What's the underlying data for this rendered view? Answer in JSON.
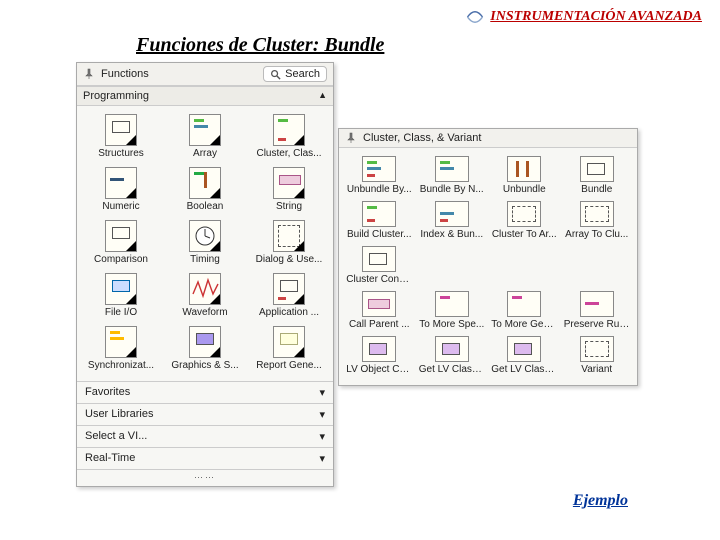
{
  "header": {
    "text": "INSTRUMENTACIÓN AVANZADA"
  },
  "title": "Funciones de Cluster: Bundle",
  "ejemplo_link": "Ejemplo",
  "functions_panel": {
    "title": "Functions",
    "search_label": "Search",
    "programming_section": "Programming",
    "items": [
      {
        "label": "Structures"
      },
      {
        "label": "Array"
      },
      {
        "label": "Cluster, Clas..."
      },
      {
        "label": "Numeric"
      },
      {
        "label": "Boolean"
      },
      {
        "label": "String"
      },
      {
        "label": "Comparison"
      },
      {
        "label": "Timing"
      },
      {
        "label": "Dialog & Use..."
      },
      {
        "label": "File I/O"
      },
      {
        "label": "Waveform"
      },
      {
        "label": "Application ..."
      },
      {
        "label": "Synchronizat..."
      },
      {
        "label": "Graphics & S..."
      },
      {
        "label": "Report Gene..."
      }
    ],
    "bottom_rows": [
      "Favorites",
      "User Libraries",
      "Select a VI...",
      "Real-Time"
    ]
  },
  "cluster_panel": {
    "title": "Cluster, Class, & Variant",
    "items": [
      {
        "label": "Unbundle By..."
      },
      {
        "label": "Bundle By N..."
      },
      {
        "label": "Unbundle"
      },
      {
        "label": "Bundle"
      },
      {
        "label": "Build Cluster..."
      },
      {
        "label": "Index & Bun..."
      },
      {
        "label": "Cluster To Ar..."
      },
      {
        "label": "Array To Clu..."
      },
      {
        "label": "Cluster Cons..."
      },
      {
        "label": "",
        "empty": true
      },
      {
        "label": "",
        "empty": true
      },
      {
        "label": "",
        "empty": true
      },
      {
        "label": "Call Parent ..."
      },
      {
        "label": "To More Spe..."
      },
      {
        "label": "To More Gen..."
      },
      {
        "label": "Preserve Run..."
      },
      {
        "label": "LV Object Co..."
      },
      {
        "label": "Get LV Class ..."
      },
      {
        "label": "Get LV Class ..."
      },
      {
        "label": "Variant"
      }
    ]
  }
}
